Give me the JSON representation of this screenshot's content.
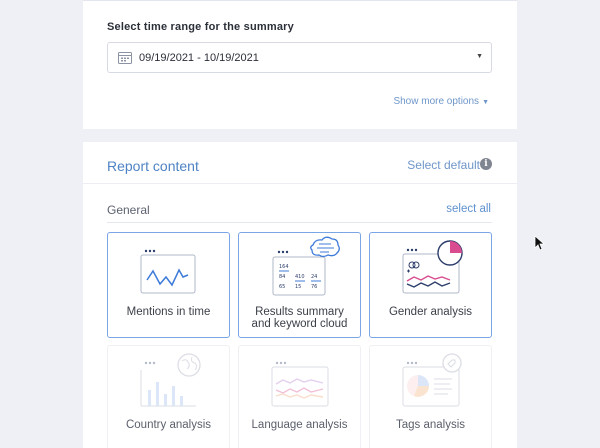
{
  "time_range": {
    "label": "Select time range for the summary",
    "value": "09/19/2021 - 10/19/2021",
    "more_options": "Show more options"
  },
  "report": {
    "title": "Report content",
    "select_default": "Select default",
    "info_glyph": "i",
    "section": "General",
    "select_all": "select all",
    "cards": [
      {
        "label": "Mentions in time",
        "icon": "line-chart-icon",
        "selected": true
      },
      {
        "label_line1": "Results summary",
        "label_line2": "and keyword cloud",
        "icon": "summary-cloud-icon",
        "selected": true
      },
      {
        "label": "Gender analysis",
        "icon": "gender-pie-icon",
        "selected": true
      },
      {
        "label": "Country analysis",
        "icon": "globe-bar-icon",
        "selected": false
      },
      {
        "label": "Language analysis",
        "icon": "language-chart-icon",
        "selected": false
      },
      {
        "label": "Tags analysis",
        "icon": "tag-pie-icon",
        "selected": false
      }
    ],
    "summary_icon_text": [
      "164",
      "84",
      "24",
      "85",
      "410",
      "24",
      "65",
      "15",
      "76"
    ]
  },
  "colors": {
    "accent": "#4e83c4",
    "selected_border": "#7aa6e6",
    "icon_pink": "#d94c8f",
    "icon_navy": "#2c3d6b"
  }
}
